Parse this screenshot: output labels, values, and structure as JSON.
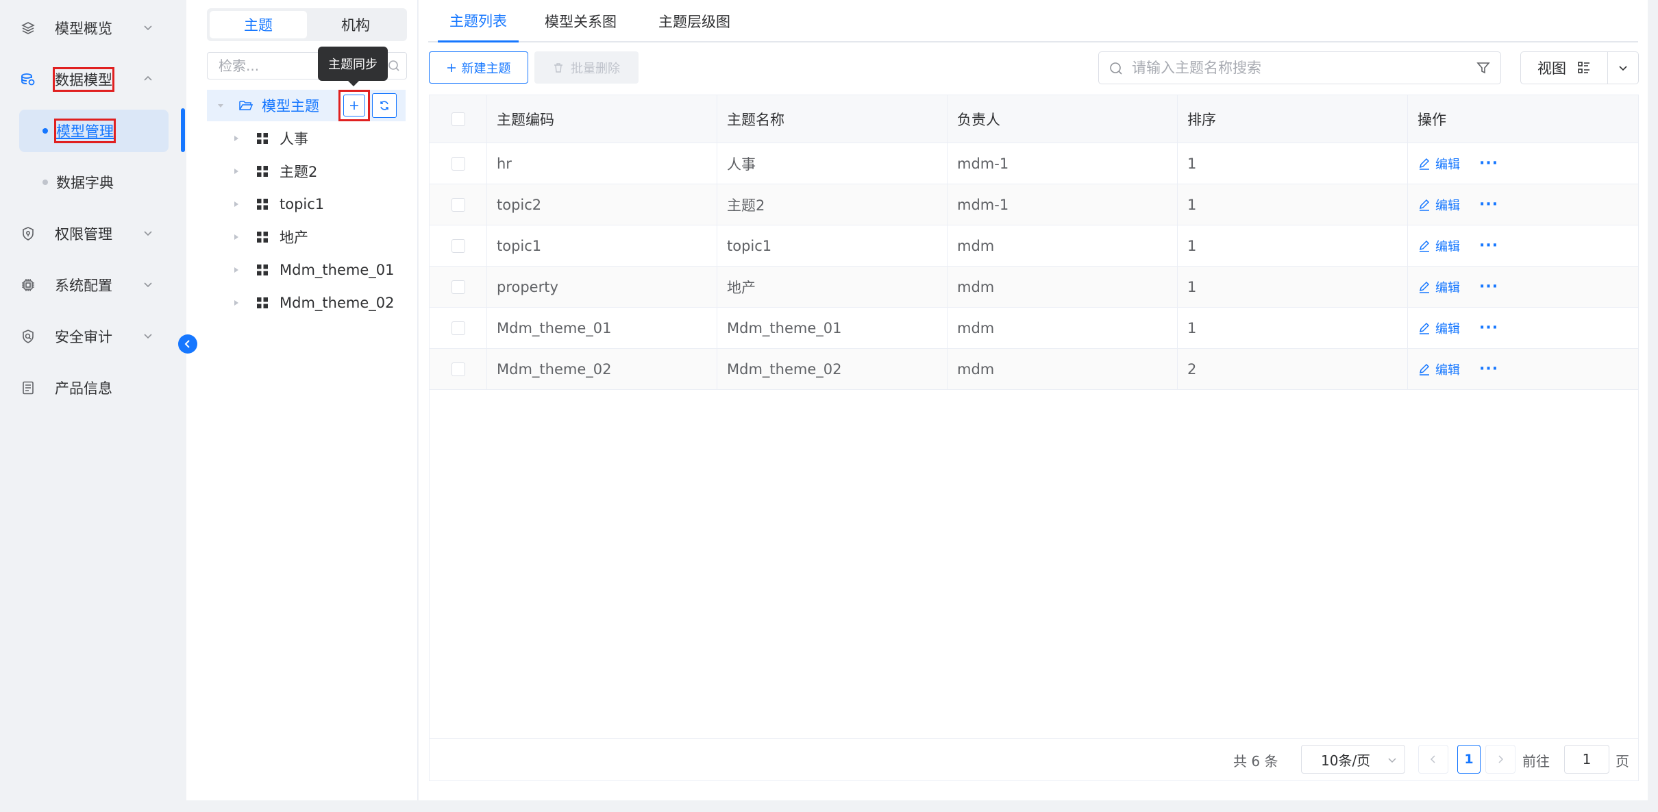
{
  "sidebar": {
    "items": [
      {
        "label": "模型概览",
        "icon": "layers-icon"
      },
      {
        "label": "数据模型",
        "icon": "database-icon"
      },
      {
        "label": "权限管理",
        "icon": "shield-icon"
      },
      {
        "label": "系统配置",
        "icon": "chip-icon"
      },
      {
        "label": "安全审计",
        "icon": "audit-shield-icon"
      },
      {
        "label": "产品信息",
        "icon": "document-icon"
      }
    ],
    "sub_items": [
      {
        "label": "模型管理"
      },
      {
        "label": "数据字典"
      }
    ]
  },
  "tree_panel": {
    "segments": [
      "主题",
      "机构"
    ],
    "search_placeholder": "检索...",
    "tooltip": "主题同步",
    "root_label": "模型主题",
    "nodes": [
      "人事",
      "主题2",
      "topic1",
      "地产",
      "Mdm_theme_01",
      "Mdm_theme_02"
    ]
  },
  "main": {
    "tabs": [
      "主题列表",
      "模型关系图",
      "主题层级图"
    ],
    "new_button": "新建主题",
    "batch_delete_button": "批量删除",
    "search_placeholder": "请输入主题名称搜索",
    "view_button": "视图",
    "table": {
      "headers": [
        "主题编码",
        "主题名称",
        "负责人",
        "排序",
        "操作"
      ],
      "rows": [
        {
          "code": "hr",
          "name": "人事",
          "owner": "mdm-1",
          "order": "1"
        },
        {
          "code": "topic2",
          "name": "主题2",
          "owner": "mdm-1",
          "order": "1"
        },
        {
          "code": "topic1",
          "name": "topic1",
          "owner": "mdm",
          "order": "1"
        },
        {
          "code": "property",
          "name": "地产",
          "owner": "mdm",
          "order": "1"
        },
        {
          "code": "Mdm_theme_01",
          "name": "Mdm_theme_01",
          "owner": "mdm",
          "order": "1"
        },
        {
          "code": "Mdm_theme_02",
          "name": "Mdm_theme_02",
          "owner": "mdm",
          "order": "2"
        }
      ],
      "edit_label": "编辑",
      "more_label": "···"
    },
    "pagination": {
      "total": "共 6 条",
      "page_size": "10条/页",
      "current_page": "1",
      "goto_label": "前往",
      "goto_value": "1",
      "page_suffix": "页"
    }
  },
  "colors": {
    "accent": "#1677ff",
    "highlight_box": "#e02020",
    "sidebar_bg": "#f0f2f5"
  }
}
